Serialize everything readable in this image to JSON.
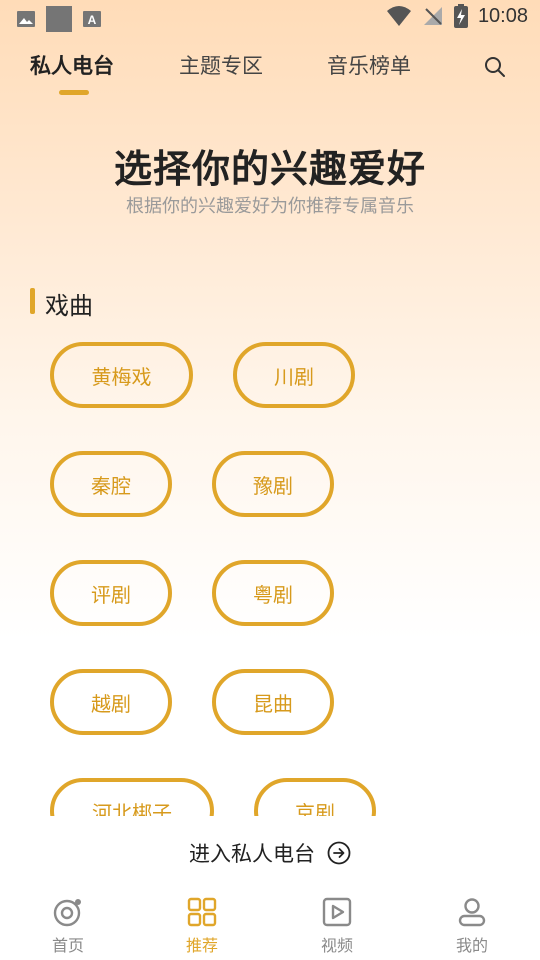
{
  "status_bar": {
    "time": "10:08"
  },
  "tabs": [
    {
      "label": "私人电台",
      "active": true
    },
    {
      "label": "主题专区",
      "active": false
    },
    {
      "label": "音乐榜单",
      "active": false
    }
  ],
  "heading": {
    "title": "选择你的兴趣爱好",
    "subtitle": "根据你的兴趣爱好为你推荐专属音乐"
  },
  "section": {
    "title": "戏曲",
    "chips": [
      "黄梅戏",
      "川剧",
      "秦腔",
      "豫剧",
      "评剧",
      "粤剧",
      "越剧",
      "昆曲",
      "河北梆子",
      "京剧"
    ]
  },
  "enter_button": {
    "label": "进入私人电台",
    "icon": "arrow-right-circle-icon"
  },
  "bottom_nav": [
    {
      "label": "首页",
      "icon": "disc-icon",
      "active": false
    },
    {
      "label": "推荐",
      "icon": "grid-icon",
      "active": true
    },
    {
      "label": "视频",
      "icon": "video-play-icon",
      "active": false
    },
    {
      "label": "我的",
      "icon": "user-icon",
      "active": false
    }
  ],
  "colors": {
    "accent": "#e0a62a",
    "chip_text": "#d79a1c"
  }
}
